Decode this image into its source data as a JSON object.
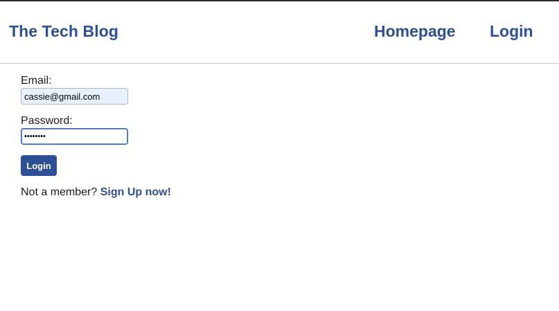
{
  "header": {
    "brand": "The Tech Blog",
    "nav": {
      "homepage": "Homepage",
      "login": "Login"
    }
  },
  "form": {
    "email_label": "Email:",
    "email_value": "cassie@gmail.com",
    "password_label": "Password:",
    "password_value": "password",
    "submit_label": "Login",
    "signup_prompt": "Not a member?",
    "signup_link": "Sign Up now!"
  },
  "colors": {
    "brand": "#2d4f93",
    "email_autofill_bg": "#e8effd",
    "focus_border": "#2d62c8"
  }
}
